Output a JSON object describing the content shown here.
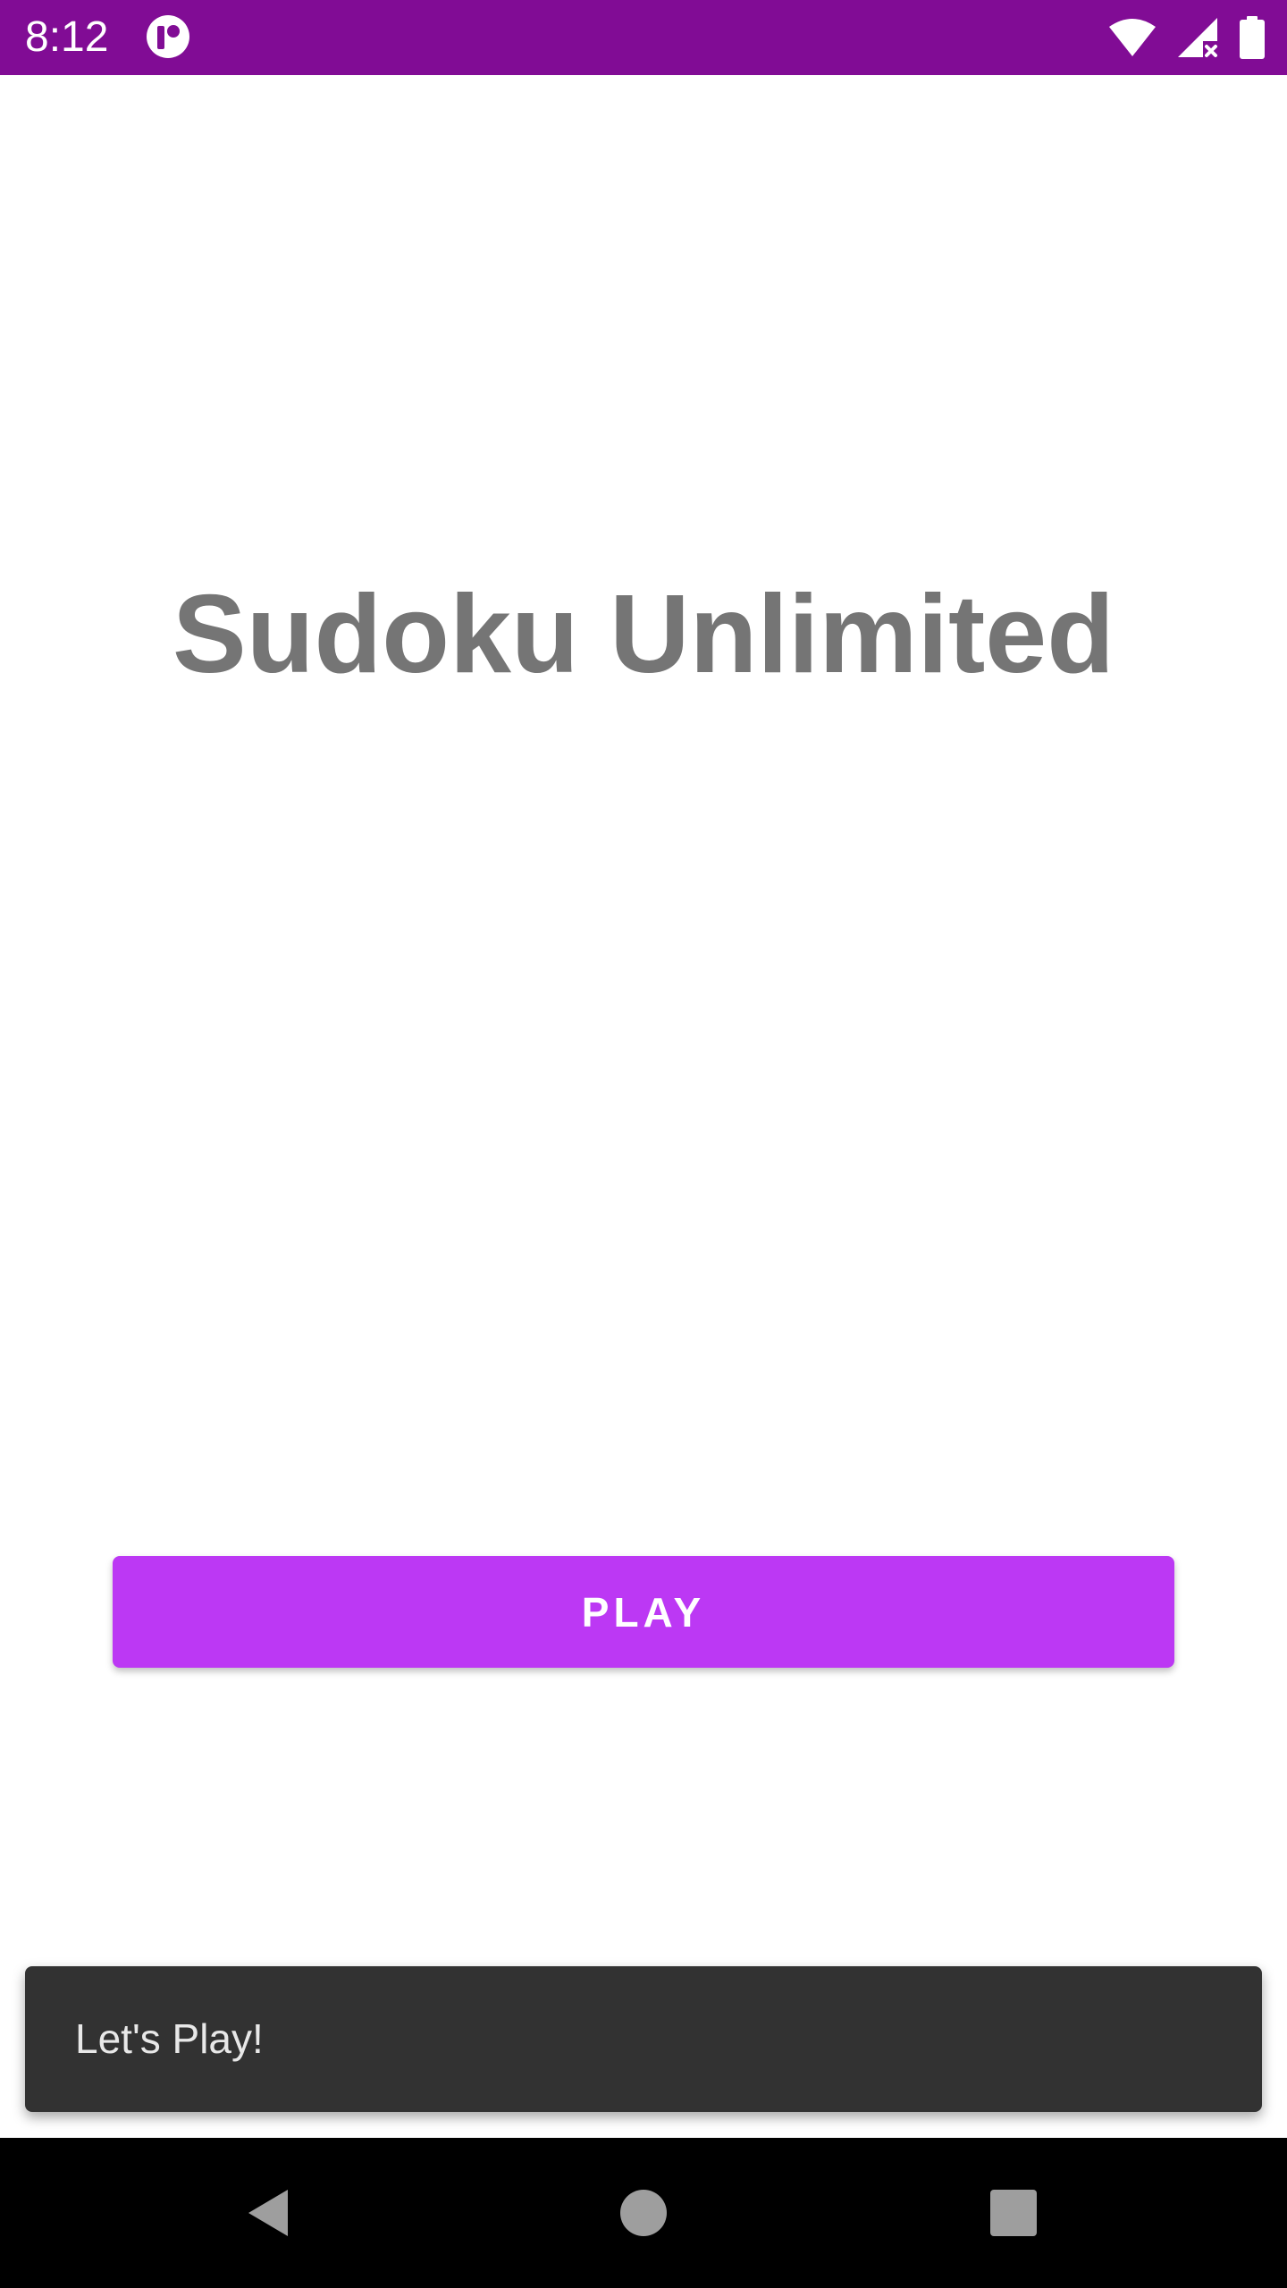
{
  "status_bar": {
    "time": "8:12",
    "background_color": "#810c95",
    "icons": [
      "app-notification-icon",
      "wifi-icon",
      "cellular-no-signal-icon",
      "battery-icon"
    ]
  },
  "main": {
    "title": "Sudoku Unlimited",
    "title_color": "#757575",
    "play_button_label": "PLAY",
    "play_button_color": "#bc38f4"
  },
  "snackbar": {
    "message": "Let's Play!"
  },
  "nav_bar": {
    "buttons": [
      "back-icon",
      "home-icon",
      "recents-icon"
    ]
  }
}
